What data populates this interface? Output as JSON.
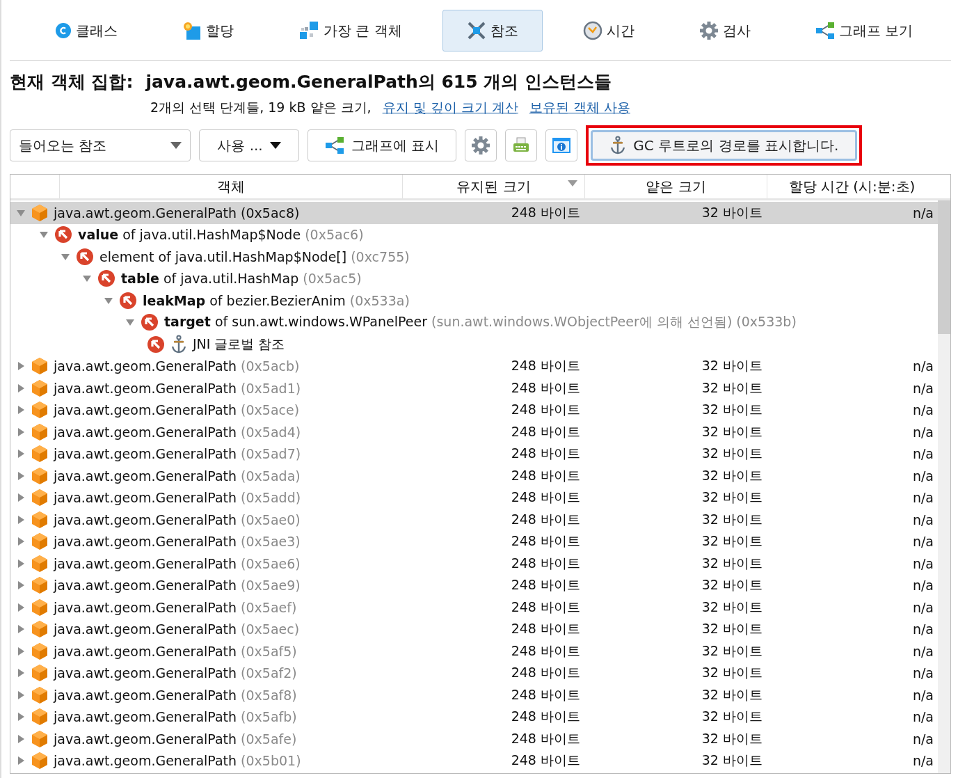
{
  "tabs": [
    {
      "label": "클래스",
      "kind": "class",
      "selected": false
    },
    {
      "label": "할당",
      "kind": "alloc",
      "selected": false
    },
    {
      "label": "가장 큰 객체",
      "kind": "biggest",
      "selected": false
    },
    {
      "label": "참조",
      "kind": "refs",
      "selected": true
    },
    {
      "label": "시간",
      "kind": "time",
      "selected": false
    },
    {
      "label": "검사",
      "kind": "inspect",
      "selected": false
    },
    {
      "label": "그래프 보기",
      "kind": "graph",
      "selected": false
    }
  ],
  "heading": {
    "label": "현재 객체 집합:",
    "value": "java.awt.geom.GeneralPath의 615 개의 인스턴스들"
  },
  "summary": {
    "text": "2개의 선택 단계들, 19 kB 얕은 크기,",
    "links": [
      "유지 및 깊이 크기 계산",
      "보유된 객체 사용"
    ]
  },
  "toolbar": {
    "view_dropdown": "들어오는 참조",
    "use_menu": "사용 ...",
    "graph_button": "그래프에 표시",
    "gc_button": {
      "label": "GC 루트로의 경로를 표시합니다.",
      "highlighted": true
    }
  },
  "table": {
    "columns": [
      {
        "label": "객체",
        "sorted": false
      },
      {
        "label": "유지된 크기",
        "sorted": true
      },
      {
        "label": "얕은 크기",
        "sorted": false
      },
      {
        "label": "할당 시간 (시:분:초)",
        "sorted": false
      }
    ],
    "rows": [
      {
        "name": "java.awt.geom.GeneralPath",
        "address": "(0x5ac8)",
        "retained": "248 바이트",
        "shallow": "32 바이트",
        "time": "n/a",
        "expanded": true,
        "selected": true,
        "children": [
          {
            "kind": "reference",
            "field": "value",
            "text": "of java.util.HashMap$Node",
            "address": "(0x5ac6)",
            "expanded": true,
            "children": [
              {
                "kind": "reference",
                "text": "element of java.util.HashMap$Node[]",
                "address": "(0xc755)",
                "expanded": true,
                "children": [
                  {
                    "kind": "reference",
                    "field": "table",
                    "text": "of java.util.HashMap",
                    "address": "(0x5ac5)",
                    "expanded": true,
                    "children": [
                      {
                        "kind": "reference",
                        "field": "leakMap",
                        "text": "of bezier.BezierAnim",
                        "address": "(0x533a)",
                        "expanded": true,
                        "children": [
                          {
                            "kind": "reference",
                            "field": "target",
                            "text": "of sun.awt.windows.WPanelPeer",
                            "note": "(sun.awt.windows.WObjectPeer에 의해 선언됨)",
                            "address": "(0x533b)",
                            "expanded": true,
                            "children": [
                              {
                                "kind": "gc-root",
                                "text": "JNI 글로벌 참조"
                              }
                            ]
                          }
                        ]
                      }
                    ]
                  }
                ]
              }
            ]
          }
        ]
      },
      {
        "name": "java.awt.geom.GeneralPath",
        "address": "(0x5acb)",
        "retained": "248 바이트",
        "shallow": "32 바이트",
        "time": "n/a",
        "expanded": false,
        "selected": false
      },
      {
        "name": "java.awt.geom.GeneralPath",
        "address": "(0x5ad1)",
        "retained": "248 바이트",
        "shallow": "32 바이트",
        "time": "n/a",
        "expanded": false,
        "selected": false
      },
      {
        "name": "java.awt.geom.GeneralPath",
        "address": "(0x5ace)",
        "retained": "248 바이트",
        "shallow": "32 바이트",
        "time": "n/a",
        "expanded": false,
        "selected": false
      },
      {
        "name": "java.awt.geom.GeneralPath",
        "address": "(0x5ad4)",
        "retained": "248 바이트",
        "shallow": "32 바이트",
        "time": "n/a",
        "expanded": false,
        "selected": false
      },
      {
        "name": "java.awt.geom.GeneralPath",
        "address": "(0x5ad7)",
        "retained": "248 바이트",
        "shallow": "32 바이트",
        "time": "n/a",
        "expanded": false,
        "selected": false
      },
      {
        "name": "java.awt.geom.GeneralPath",
        "address": "(0x5ada)",
        "retained": "248 바이트",
        "shallow": "32 바이트",
        "time": "n/a",
        "expanded": false,
        "selected": false
      },
      {
        "name": "java.awt.geom.GeneralPath",
        "address": "(0x5add)",
        "retained": "248 바이트",
        "shallow": "32 바이트",
        "time": "n/a",
        "expanded": false,
        "selected": false
      },
      {
        "name": "java.awt.geom.GeneralPath",
        "address": "(0x5ae0)",
        "retained": "248 바이트",
        "shallow": "32 바이트",
        "time": "n/a",
        "expanded": false,
        "selected": false
      },
      {
        "name": "java.awt.geom.GeneralPath",
        "address": "(0x5ae3)",
        "retained": "248 바이트",
        "shallow": "32 바이트",
        "time": "n/a",
        "expanded": false,
        "selected": false
      },
      {
        "name": "java.awt.geom.GeneralPath",
        "address": "(0x5ae6)",
        "retained": "248 바이트",
        "shallow": "32 바이트",
        "time": "n/a",
        "expanded": false,
        "selected": false
      },
      {
        "name": "java.awt.geom.GeneralPath",
        "address": "(0x5ae9)",
        "retained": "248 바이트",
        "shallow": "32 바이트",
        "time": "n/a",
        "expanded": false,
        "selected": false
      },
      {
        "name": "java.awt.geom.GeneralPath",
        "address": "(0x5aef)",
        "retained": "248 바이트",
        "shallow": "32 바이트",
        "time": "n/a",
        "expanded": false,
        "selected": false
      },
      {
        "name": "java.awt.geom.GeneralPath",
        "address": "(0x5aec)",
        "retained": "248 바이트",
        "shallow": "32 바이트",
        "time": "n/a",
        "expanded": false,
        "selected": false
      },
      {
        "name": "java.awt.geom.GeneralPath",
        "address": "(0x5af5)",
        "retained": "248 바이트",
        "shallow": "32 바이트",
        "time": "n/a",
        "expanded": false,
        "selected": false
      },
      {
        "name": "java.awt.geom.GeneralPath",
        "address": "(0x5af2)",
        "retained": "248 바이트",
        "shallow": "32 바이트",
        "time": "n/a",
        "expanded": false,
        "selected": false
      },
      {
        "name": "java.awt.geom.GeneralPath",
        "address": "(0x5af8)",
        "retained": "248 바이트",
        "shallow": "32 바이트",
        "time": "n/a",
        "expanded": false,
        "selected": false
      },
      {
        "name": "java.awt.geom.GeneralPath",
        "address": "(0x5afb)",
        "retained": "248 바이트",
        "shallow": "32 바이트",
        "time": "n/a",
        "expanded": false,
        "selected": false
      },
      {
        "name": "java.awt.geom.GeneralPath",
        "address": "(0x5afe)",
        "retained": "248 바이트",
        "shallow": "32 바이트",
        "time": "n/a",
        "expanded": false,
        "selected": false
      },
      {
        "name": "java.awt.geom.GeneralPath",
        "address": "(0x5b01)",
        "retained": "248 바이트",
        "shallow": "32 바이트",
        "time": "n/a",
        "expanded": false,
        "selected": false
      }
    ]
  }
}
